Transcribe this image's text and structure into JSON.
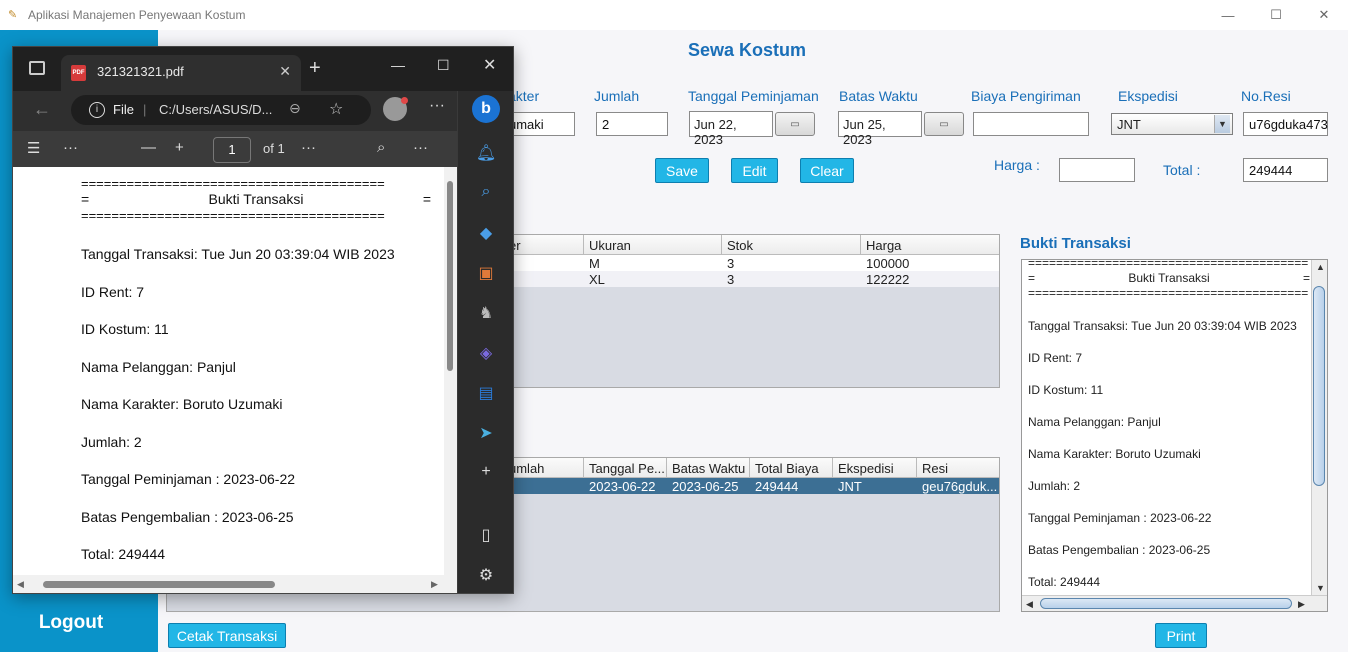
{
  "window": {
    "title": "Aplikasi Manajemen Penyewaan Kostum"
  },
  "sidebar": {
    "logout": "Logout"
  },
  "form": {
    "page_title": "Sewa Kostum",
    "labels": {
      "karakter": "akter",
      "jumlah": "Jumlah",
      "tanggal_peminjaman": "Tanggal Peminjaman",
      "batas_waktu": "Batas Waktu",
      "biaya_pengiriman": "Biaya Pengiriman",
      "ekspedisi": "Ekspedisi",
      "no_resi": "No.Resi",
      "harga": "Harga :",
      "total": "Total :"
    },
    "values": {
      "karakter": "umaki",
      "jumlah": "2",
      "tanggal_peminjaman": "Jun 22, 2023",
      "batas_waktu": "Jun 25, 2023",
      "biaya_pengiriman": "",
      "ekspedisi": "JNT",
      "no_resi": "u76gduka473",
      "harga": "",
      "total": "249444"
    },
    "buttons": {
      "save": "Save",
      "edit": "Edit",
      "clear": "Clear"
    }
  },
  "kostum_table": {
    "headers": [
      "er",
      "Ukuran",
      "Stok",
      "Harga"
    ],
    "rows": [
      [
        "",
        "M",
        "3",
        "100000"
      ],
      [
        "",
        "XL",
        "3",
        "122222"
      ]
    ]
  },
  "rent_table": {
    "headers": [
      "umlah",
      "Tanggal Pe...",
      "Batas Waktu",
      "Total Biaya",
      "Ekspedisi",
      "Resi"
    ],
    "rows": [
      [
        "",
        "2023-06-22",
        "2023-06-25",
        "249444",
        "JNT",
        "geu76gduk..."
      ]
    ]
  },
  "bukti": {
    "title": "Bukti Transaksi",
    "rule": "========================================",
    "head_left": "=",
    "head_center": "Bukti Transaksi",
    "head_right": "=",
    "lines": [
      "Tanggal Transaksi: Tue Jun 20 03:39:04 WIB 2023",
      "ID Rent: 7",
      "ID Kostum: 11",
      "Nama Pelanggan: Panjul",
      "Nama Karakter: Boruto Uzumaki",
      "Jumlah: 2",
      "Tanggal Peminjaman : 2023-06-22",
      "Batas Pengembalian : 2023-06-25",
      "Total: 249444"
    ]
  },
  "bottom_buttons": {
    "cetak": "Cetak Transaksi",
    "print": "Print"
  },
  "pdf_viewer": {
    "tab_title": "321321321.pdf",
    "url_scheme": "File",
    "url_path": "C:/Users/ASUS/D...",
    "page_current": "1",
    "page_total": "of 1",
    "rule": "========================================",
    "head_left": "=",
    "head_center": "Bukti Transaksi",
    "head_right": "=",
    "lines": [
      "Tanggal Transaksi: Tue Jun 20 03:39:04 WIB 2023",
      "ID Rent: 7",
      "ID Kostum: 11",
      "Nama Pelanggan: Panjul",
      "Nama Karakter: Boruto Uzumaki",
      "Jumlah: 2",
      "Tanggal Peminjaman : 2023-06-22",
      "Batas Pengembalian : 2023-06-25",
      "Total: 249444"
    ]
  },
  "colors": {
    "sidebar": "#0a93c9",
    "accent_text": "#1a6fb8",
    "button": "#22b6e6",
    "selected_row": "#3c6f94"
  }
}
